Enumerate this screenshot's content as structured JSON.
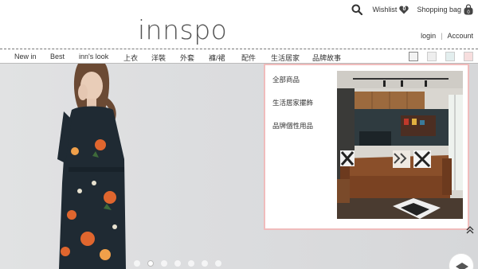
{
  "brand": {
    "logo_text": "innspo"
  },
  "top_bar": {
    "wishlist_label": "Wishlist",
    "wishlist_count": "0",
    "cart_label": "Shopping bag",
    "cart_count": "0"
  },
  "account": {
    "login_label": "login",
    "separator": "|",
    "account_label": "Account"
  },
  "nav": {
    "items": [
      "New in",
      "Best",
      "inn's look",
      "上衣",
      "洋裝",
      "外套",
      "褲/裙",
      "配件",
      "生活居家",
      "品牌故事"
    ]
  },
  "swatches": [
    "#f2f2f2",
    "#eeeeee",
    "#e3eeee",
    "#f7dede"
  ],
  "dropdown": {
    "items": [
      "全部商品",
      "生活居家擺飾",
      "品牌個性用品"
    ]
  },
  "carousel": {
    "slide_count": 7,
    "active_index": 1
  },
  "colors": {
    "accent_border": "#f0bcbc"
  }
}
